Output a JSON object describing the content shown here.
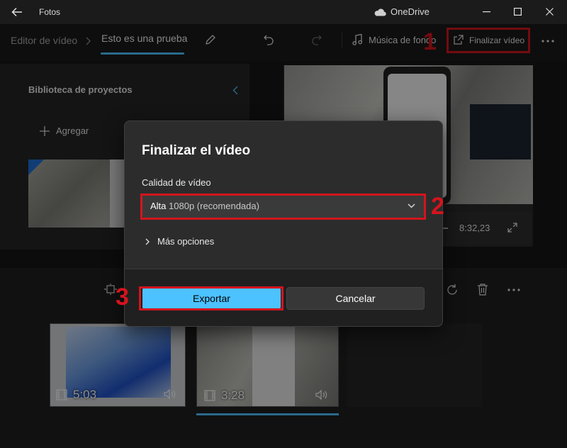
{
  "window": {
    "app_title": "Fotos",
    "onedrive_label": "OneDrive"
  },
  "breadcrumb": {
    "parent": "Editor de vídeo",
    "current": "Esto es una prueba"
  },
  "toolbar": {
    "music_label": "Música de fondo",
    "finalize_label": "Finalizar vídeo"
  },
  "library": {
    "title": "Biblioteca de proyectos",
    "add_label": "Agregar"
  },
  "preview": {
    "time": "8:32,23"
  },
  "dialog": {
    "title": "Finalizar el vídeo",
    "quality_label": "Calidad de vídeo",
    "quality_strong": "Alta",
    "quality_rest": "1080p (recomendada)",
    "more_options": "Más opciones",
    "export_label": "Exportar",
    "cancel_label": "Cancelar"
  },
  "timeline": {
    "clips": [
      {
        "duration": "5:03"
      },
      {
        "duration": "3:28"
      }
    ]
  },
  "annotations": {
    "step1": "1",
    "step2": "2",
    "step3": "3"
  },
  "colors": {
    "accent": "#4cc2ff",
    "highlight_red": "#d4141d",
    "dialog_bg": "#2c2c2c"
  },
  "icons": [
    "back-arrow-icon",
    "cloud-icon",
    "minimize-icon",
    "maximize-icon",
    "close-icon",
    "pencil-icon",
    "undo-icon",
    "redo-icon",
    "music-note-icon",
    "share-export-icon",
    "more-icon",
    "plus-icon",
    "collapse-chevron-icon",
    "expand-icon",
    "chevron-down-icon",
    "chevron-right-icon",
    "film-icon",
    "speaker-icon",
    "resize-icon",
    "rotate-icon",
    "trash-icon"
  ]
}
